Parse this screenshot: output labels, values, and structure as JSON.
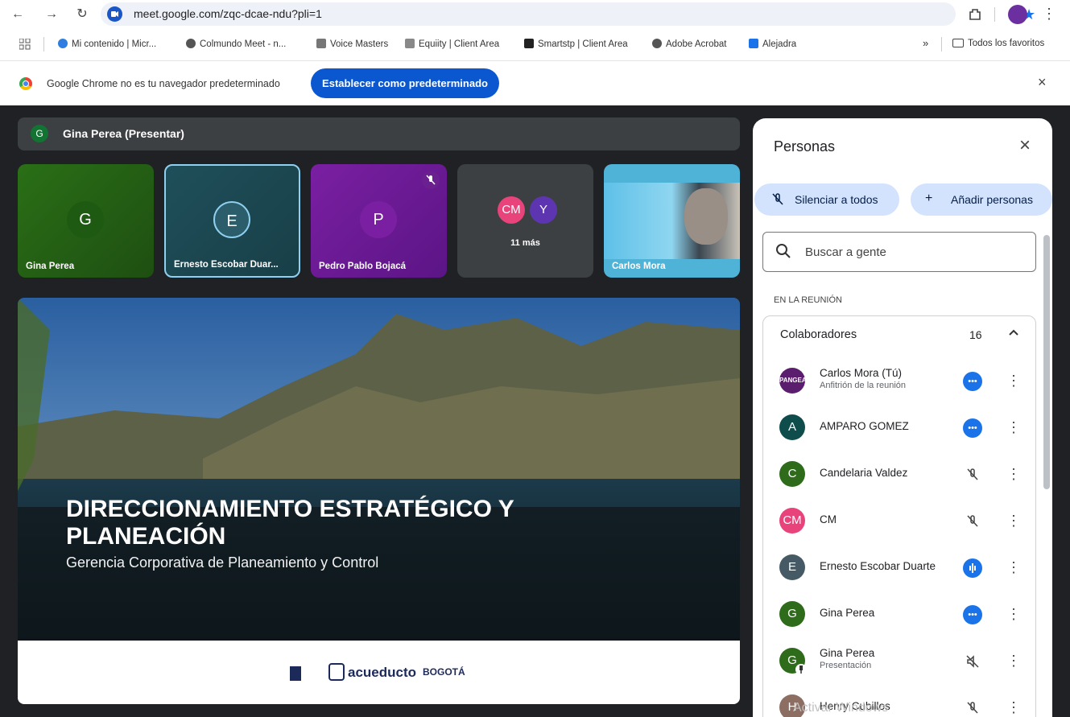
{
  "browser": {
    "url": "meet.google.com/zqc-dcae-ndu?pli=1"
  },
  "bookmarks": {
    "items": [
      {
        "label": "Mi contenido | Micr..."
      },
      {
        "label": "Colmundo Meet - n..."
      },
      {
        "label": "Voice Masters"
      },
      {
        "label": "Equiity | Client Area"
      },
      {
        "label": "Smartstp | Client Area"
      },
      {
        "label": "Adobe Acrobat"
      },
      {
        "label": "Alejadra"
      }
    ],
    "overflow": "»",
    "all_favorites": "Todos los favoritos"
  },
  "infobar": {
    "message": "Google Chrome no es tu navegador predeterminado",
    "button": "Establecer como predeterminado",
    "close": "×"
  },
  "meet": {
    "presenter": {
      "initial": "G",
      "label": "Gina Perea (Presentar)"
    },
    "tiles": [
      {
        "initial": "G",
        "name": "Gina Perea"
      },
      {
        "initial": "E",
        "name": "Ernesto Escobar Duar..."
      },
      {
        "initial": "P",
        "name": "Pedro Pablo Bojacá"
      },
      {
        "initials": [
          "CM",
          "Y"
        ],
        "more": "11 más"
      },
      {
        "name": "Carlos Mora"
      }
    ],
    "slide": {
      "title": "DIRECCIONAMIENTO ESTRATÉGICO Y PLANEACIÓN",
      "subtitle": "Gerencia Corporativa de Planeamiento y Control",
      "footer_brand": "acueducto",
      "footer_city": "BOGOTÁ"
    }
  },
  "panel": {
    "title": "Personas",
    "mute_all": "Silenciar a todos",
    "add_people": "Añadir personas",
    "search_placeholder": "Buscar a gente",
    "section": "EN LA REUNIÓN",
    "group_label": "Colaboradores",
    "group_count": "16",
    "people": [
      {
        "initial": "",
        "name": "Carlos Mora (Tú)",
        "sub": "Anfitrión de la reunión",
        "status": "more"
      },
      {
        "initial": "A",
        "name": "AMPARO GOMEZ",
        "sub": "",
        "status": "more"
      },
      {
        "initial": "C",
        "name": "Candelaria Valdez",
        "sub": "",
        "status": "muted"
      },
      {
        "initial": "CM",
        "name": "CM",
        "sub": "",
        "status": "muted"
      },
      {
        "initial": "E",
        "name": "Ernesto Escobar Duarte",
        "sub": "",
        "status": "speaking"
      },
      {
        "initial": "G",
        "name": "Gina Perea",
        "sub": "",
        "status": "more"
      },
      {
        "initial": "G",
        "name": "Gina Perea",
        "sub": "Presentación",
        "status": "audio-off"
      },
      {
        "initial": "H",
        "name": "Henry Cubillos",
        "sub": "",
        "status": "muted"
      }
    ]
  },
  "watermark": "Activar Windows"
}
